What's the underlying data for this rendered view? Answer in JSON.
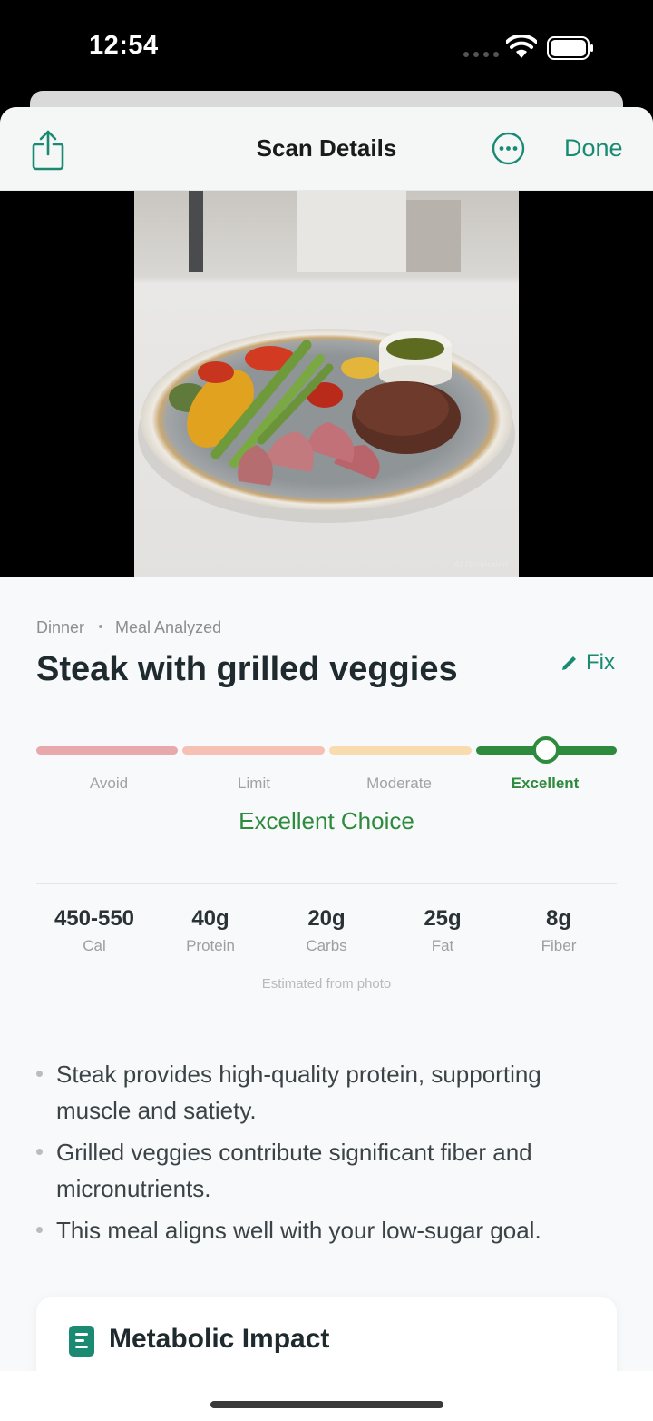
{
  "status": {
    "time": "12:54"
  },
  "nav": {
    "title": "Scan Details",
    "done_label": "Done"
  },
  "photo": {
    "ai_tag": "AI Generated"
  },
  "meal": {
    "category": "Dinner",
    "status": "Meal Analyzed",
    "title": "Steak with grilled veggies",
    "fix_label": "Fix"
  },
  "rating": {
    "levels": [
      "Avoid",
      "Limit",
      "Moderate",
      "Excellent"
    ],
    "selected": "Excellent",
    "verdict": "Excellent Choice",
    "colors": {
      "avoid": "#e8a9ac",
      "limit": "#f6c0b4",
      "moderate": "#f8dcb0",
      "excellent": "#2e8a3c"
    }
  },
  "macros": [
    {
      "value": "450-550",
      "label": "Cal"
    },
    {
      "value": "40g",
      "label": "Protein"
    },
    {
      "value": "20g",
      "label": "Carbs"
    },
    {
      "value": "25g",
      "label": "Fat"
    },
    {
      "value": "8g",
      "label": "Fiber"
    }
  ],
  "estimate_note": "Estimated from photo",
  "insights": [
    "Steak provides high-quality protein, supporting muscle and satiety.",
    "Grilled veggies contribute significant fiber and micronutrients.",
    "This meal aligns well with your low-sugar goal."
  ],
  "card": {
    "title": "Metabolic Impact",
    "icon": "document-icon"
  },
  "accent": "#1a8a73"
}
